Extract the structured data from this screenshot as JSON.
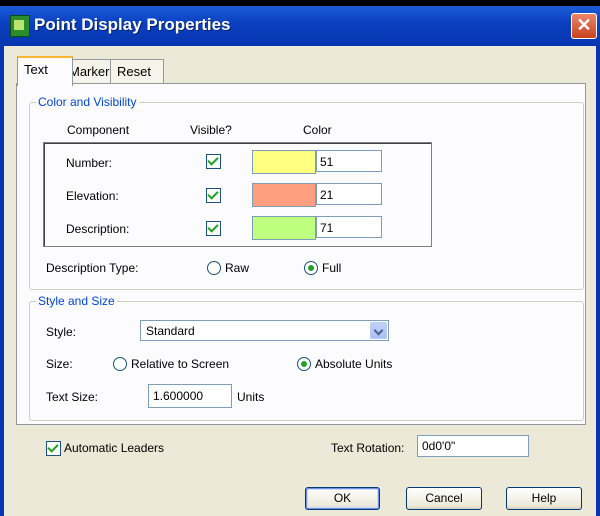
{
  "window": {
    "title": "Point Display Properties",
    "close_glyph": "✕"
  },
  "tabs": [
    {
      "label": "Text"
    },
    {
      "label": "Marker"
    },
    {
      "label": "Reset"
    }
  ],
  "color_visibility": {
    "group_title": "Color and Visibility",
    "col_component": "Component",
    "col_visible": "Visible?",
    "col_color": "Color",
    "rows": [
      {
        "label": "Number:",
        "visible": true,
        "color_hex": "#ffff80",
        "color_index": "51"
      },
      {
        "label": "Elevation:",
        "visible": true,
        "color_hex": "#ff9f80",
        "color_index": "21"
      },
      {
        "label": "Description:",
        "visible": true,
        "color_hex": "#bfff80",
        "color_index": "71"
      }
    ]
  },
  "description_type": {
    "label": "Description Type:",
    "options": [
      "Raw",
      "Full"
    ],
    "selected": "Full"
  },
  "style_size": {
    "group_title": "Style and Size",
    "style_label": "Style:",
    "style_value": "Standard",
    "size_label": "Size:",
    "size_options": [
      "Relative to Screen",
      "Absolute Units"
    ],
    "size_selected": "Absolute Units",
    "text_size_label": "Text Size:",
    "text_size_value": "1.600000",
    "text_size_unit": "Units"
  },
  "automatic_leaders": {
    "label": "Automatic Leaders",
    "checked": true
  },
  "text_rotation": {
    "label": "Text Rotation:",
    "value": "0d0'0\""
  },
  "buttons": {
    "ok": "OK",
    "cancel": "Cancel",
    "help": "Help"
  },
  "colors": {
    "titlebar": "#0a3fbf",
    "accent_group_title": "#0046d5",
    "check_green": "#21a121"
  }
}
